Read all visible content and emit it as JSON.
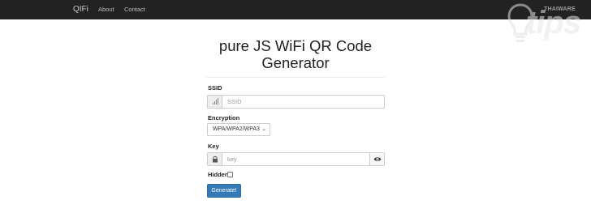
{
  "navbar": {
    "brand": "QIFi",
    "links": [
      {
        "label": "About"
      },
      {
        "label": "Contact"
      }
    ]
  },
  "watermark": {
    "brand": "THAIWARE",
    "tips": "tips"
  },
  "page": {
    "title": "pure JS WiFi QR Code Generator"
  },
  "form": {
    "ssid": {
      "label": "SSID",
      "placeholder": "SSID",
      "icon": "signal-icon"
    },
    "encryption": {
      "label": "Encryption",
      "selected": "WPA/WPA2/WPA3"
    },
    "key": {
      "label": "Key",
      "placeholder": "key",
      "icon": "lock-icon",
      "toggle_icon": "eye-icon"
    },
    "hidden": {
      "label": "Hidden",
      "checked": false
    },
    "submit_label": "Generate!"
  },
  "colors": {
    "navbar": "#222222",
    "primary_button": "#337ab7"
  }
}
